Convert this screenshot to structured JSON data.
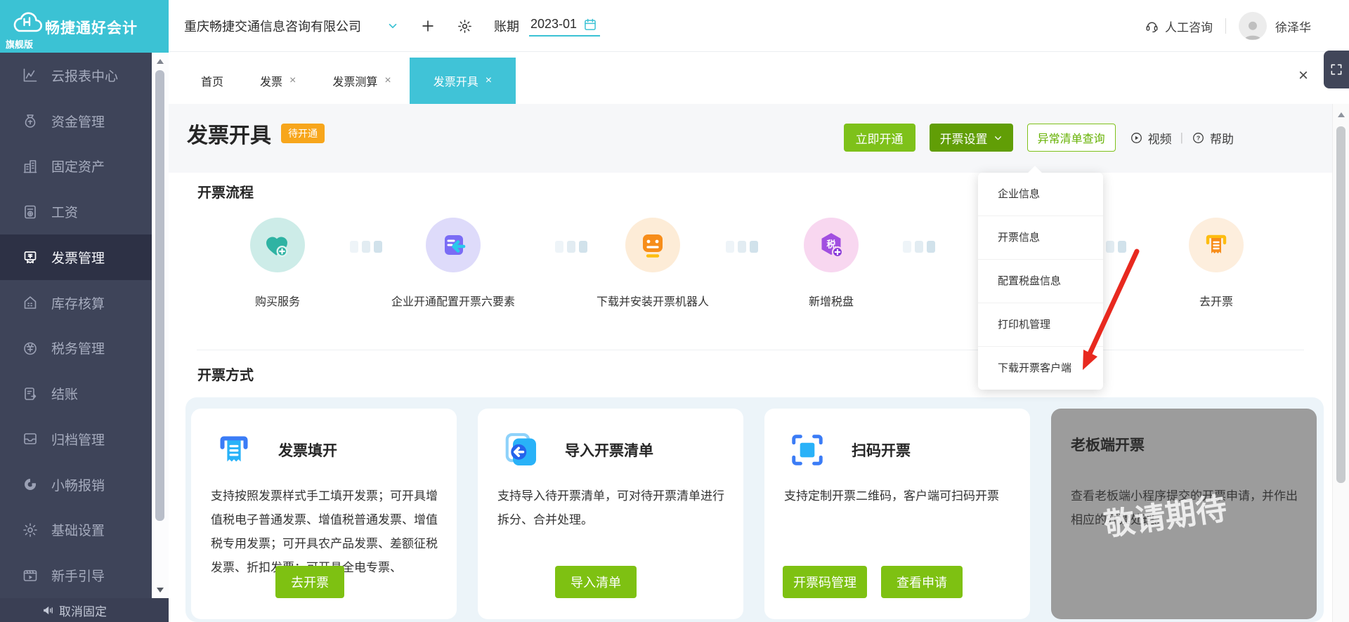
{
  "brand": {
    "name": "畅捷通好会计",
    "edition": "旗舰版"
  },
  "topbar": {
    "company": "重庆畅捷交通信息咨询有限公司",
    "period_label": "账期",
    "period_value": "2023-01",
    "support": "人工咨询",
    "username": "徐泽华"
  },
  "tabs": {
    "close_glyph": "×",
    "close_all_glyph": "×",
    "items": [
      {
        "label": "首页"
      },
      {
        "label": "发票"
      },
      {
        "label": "发票测算"
      },
      {
        "label": "发票开具"
      }
    ]
  },
  "sidebar": {
    "unpin": "取消固定",
    "items": [
      {
        "label": "云报表中心"
      },
      {
        "label": "资金管理"
      },
      {
        "label": "固定资产"
      },
      {
        "label": "工资"
      },
      {
        "label": "发票管理"
      },
      {
        "label": "库存核算"
      },
      {
        "label": "税务管理"
      },
      {
        "label": "结账"
      },
      {
        "label": "归档管理"
      },
      {
        "label": "小畅报销"
      },
      {
        "label": "基础设置"
      },
      {
        "label": "新手引导"
      }
    ]
  },
  "page": {
    "title": "发票开具",
    "badge": "待开通",
    "actions": {
      "activate": "立即开通",
      "settings": "开票设置",
      "abnormal": "异常清单查询",
      "video": "视频",
      "help": "帮助"
    }
  },
  "settings_menu": {
    "items": [
      "企业信息",
      "开票信息",
      "配置税盘信息",
      "打印机管理",
      "下载开票客户端"
    ]
  },
  "flow": {
    "title": "开票流程",
    "tax_glyph": "税",
    "steps": [
      "购买服务",
      "企业开通配置开票六要素",
      "下载并安装开票机器人",
      "新增税盘",
      "去开票"
    ]
  },
  "methods": {
    "title": "开票方式",
    "watermark": "敬请期待",
    "cards": [
      {
        "title": "发票填开",
        "desc": "支持按照发票样式手工填开发票；可开具增值税电子普通发票、增值税普通发票、增值税专用发票；可开具农产品发票、差额征税发票、折扣发票；可开具全电专票、",
        "buttons": [
          "去开票"
        ]
      },
      {
        "title": "导入开票清单",
        "desc": "支持导入待开票清单，可对待开票清单进行拆分、合并处理。",
        "buttons": [
          "导入清单"
        ]
      },
      {
        "title": "扫码开票",
        "desc": "支持定制开票二维码，客户端可扫码开票",
        "buttons": [
          "开票码管理",
          "查看申请"
        ]
      },
      {
        "title": "老板端开票",
        "desc": "查看老板端小程序提交的开票申请，并作出相应的开票处理。",
        "buttons": []
      }
    ]
  },
  "colors": {
    "accent_cyan": "#3bc2d4",
    "green": "#7ec11a",
    "dark_green": "#619e06",
    "badge_orange": "#f7a61c",
    "arrow_red": "#e8291f",
    "sidebar_bg": "#3e4459"
  }
}
